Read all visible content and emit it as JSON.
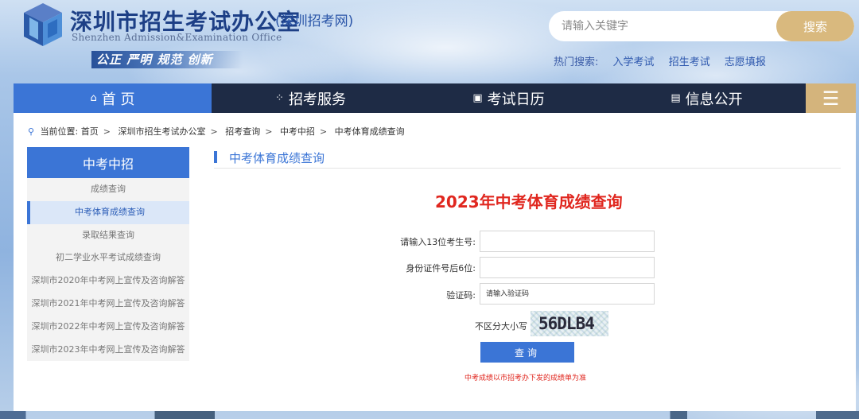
{
  "header": {
    "title": "深圳市招生考试办公室",
    "subtitle": "(深圳招考网)",
    "title_en": "Shenzhen Admission&Examination Office",
    "slogan": "公正 严明 规范 创新",
    "logo_icon": "cube-logo-icon"
  },
  "search": {
    "placeholder": "请输入关键字",
    "button_label": "搜索",
    "hot_label": "热门搜索:",
    "hot_links": [
      "入学考试",
      "招生考试",
      "志愿填报"
    ]
  },
  "nav": {
    "items": [
      {
        "label": "首 页",
        "icon": "home-icon",
        "glyph": "⌂",
        "active": true
      },
      {
        "label": "招考服务",
        "icon": "grid-icon",
        "glyph": "⁘",
        "active": false
      },
      {
        "label": "考试日历",
        "icon": "calendar-icon",
        "glyph": "▣",
        "active": false
      },
      {
        "label": "信息公开",
        "icon": "document-icon",
        "glyph": "▤",
        "active": false
      }
    ],
    "menu_icon": "hamburger-menu-icon",
    "menu_glyph": "☰"
  },
  "breadcrumb": {
    "label": "当前位置:",
    "items": [
      "首页",
      "深圳市招生考试办公室",
      "招考查询",
      "中考中招",
      "中考体育成绩查询"
    ]
  },
  "sidebar": {
    "title": "中考中招",
    "items": [
      {
        "label": "成绩查询",
        "active": false
      },
      {
        "label": "中考体育成绩查询",
        "active": true
      },
      {
        "label": "录取结果查询",
        "active": false
      },
      {
        "label": "初二学业水平考试成绩查询",
        "active": false
      },
      {
        "label": "深圳市2020年中考网上宣传及咨询解答",
        "active": false
      },
      {
        "label": "深圳市2021年中考网上宣传及咨询解答",
        "active": false
      },
      {
        "label": "深圳市2022年中考网上宣传及咨询解答",
        "active": false
      },
      {
        "label": "深圳市2023年中考网上宣传及咨询解答",
        "active": false
      }
    ]
  },
  "main": {
    "section_title": "中考体育成绩查询",
    "form_title": "2023年中考体育成绩查询",
    "fields": {
      "exam_no_label": "请输入13位考生号:",
      "exam_no_value": "",
      "id_label": "身份证件号后6位:",
      "id_value": "",
      "captcha_label": "验证码:",
      "captcha_placeholder": "请输入验证码"
    },
    "case_note": "不区分大小写",
    "captcha_text": "56DLB4",
    "submit_label": "查询",
    "note": "中考成绩以市招考办下发的成绩单为准"
  },
  "colors": {
    "primary": "#3b75d6",
    "nav_bg": "#1e2b45",
    "gold": "#d4b47c",
    "title_red": "#e0271f",
    "brand_blue": "#1d3f86"
  }
}
